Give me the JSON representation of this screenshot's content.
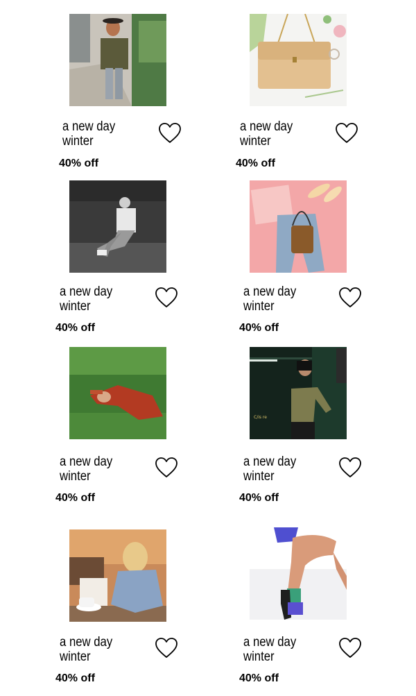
{
  "products": [
    {
      "brand_line1": "a new day",
      "brand_line2": "winter",
      "discount": "40% off",
      "image": "woman-walking-street-photo",
      "favorite_icon": "heart-outline-icon"
    },
    {
      "brand_line1": "a new day",
      "brand_line2": "winter",
      "discount": "40% off",
      "image": "beige-chain-handbag-photo",
      "favorite_icon": "heart-outline-icon"
    },
    {
      "brand_line1": "a new day",
      "brand_line2": "winter",
      "discount": "40% off",
      "image": "man-sitting-grass-bw-photo",
      "favorite_icon": "heart-outline-icon"
    },
    {
      "brand_line1": "a new day",
      "brand_line2": "winter",
      "discount": "40% off",
      "image": "jeans-flatlay-pink-photo",
      "favorite_icon": "heart-outline-icon"
    },
    {
      "brand_line1": "a new day",
      "brand_line2": "winter",
      "discount": "40% off",
      "image": "woman-lying-in-grass-photo",
      "favorite_icon": "heart-outline-icon"
    },
    {
      "brand_line1": "a new day",
      "brand_line2": "winter",
      "discount": "40% off",
      "image": "woman-green-tile-wall-photo",
      "favorite_icon": "heart-outline-icon"
    },
    {
      "brand_line1": "a new day",
      "brand_line2": "winter",
      "discount": "40% off",
      "image": "woman-cafe-coffee-photo",
      "favorite_icon": "heart-outline-icon"
    },
    {
      "brand_line1": "a new day",
      "brand_line2": "winter",
      "discount": "40% off",
      "image": "legs-sandals-socks-photo",
      "favorite_icon": "heart-outline-icon"
    }
  ]
}
